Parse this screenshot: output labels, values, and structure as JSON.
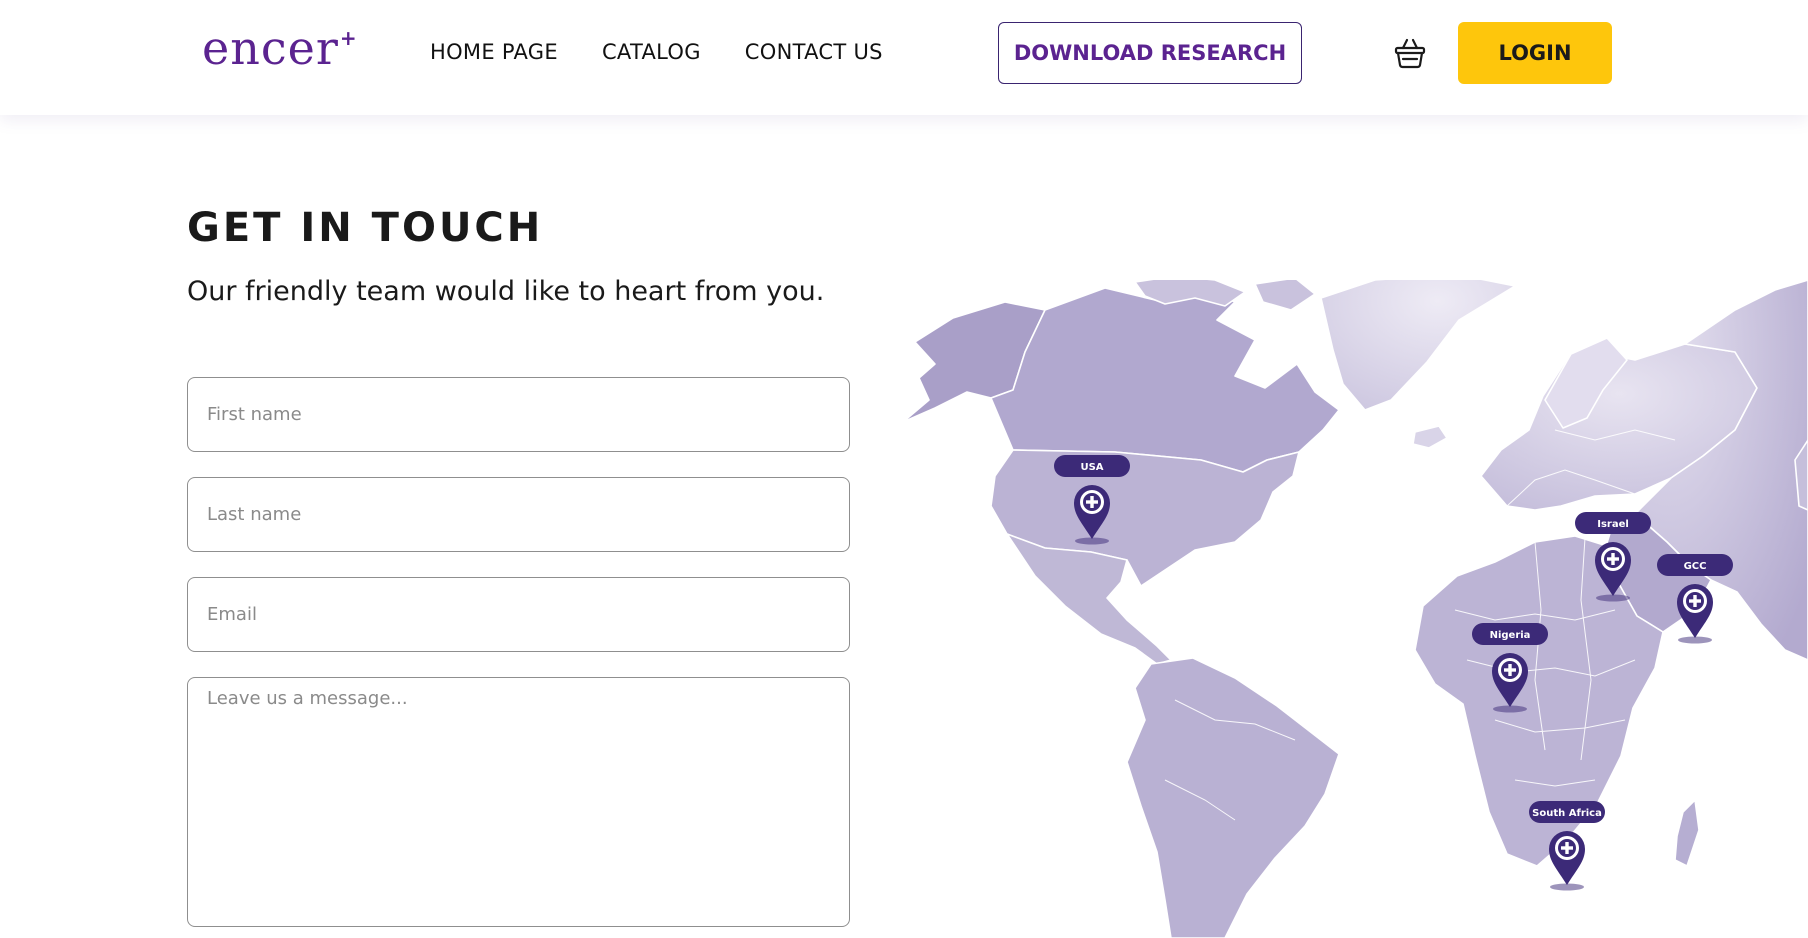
{
  "brand": {
    "logo_text": "encer",
    "logo_mark": "+",
    "accent_color": "#5b2390",
    "login_color": "#fec60c"
  },
  "nav": {
    "items": [
      "HOME PAGE",
      "CATALOG",
      "CONTACT US"
    ]
  },
  "header": {
    "download_label": "DOWNLOAD RESEARCH",
    "cart_icon": "basket-icon",
    "login_label": "LOGIN"
  },
  "contact": {
    "title": "GET IN TOUCH",
    "subtitle": "Our friendly team would like to heart from you.",
    "first_name_placeholder": "First name",
    "last_name_placeholder": "Last name",
    "email_placeholder": "Email",
    "message_placeholder": "Leave us a message..."
  },
  "map": {
    "pin_icon": "map-pin-plus-icon",
    "locations": [
      "USA",
      "Israel",
      "GCC",
      "Nigeria",
      "South Africa"
    ]
  }
}
